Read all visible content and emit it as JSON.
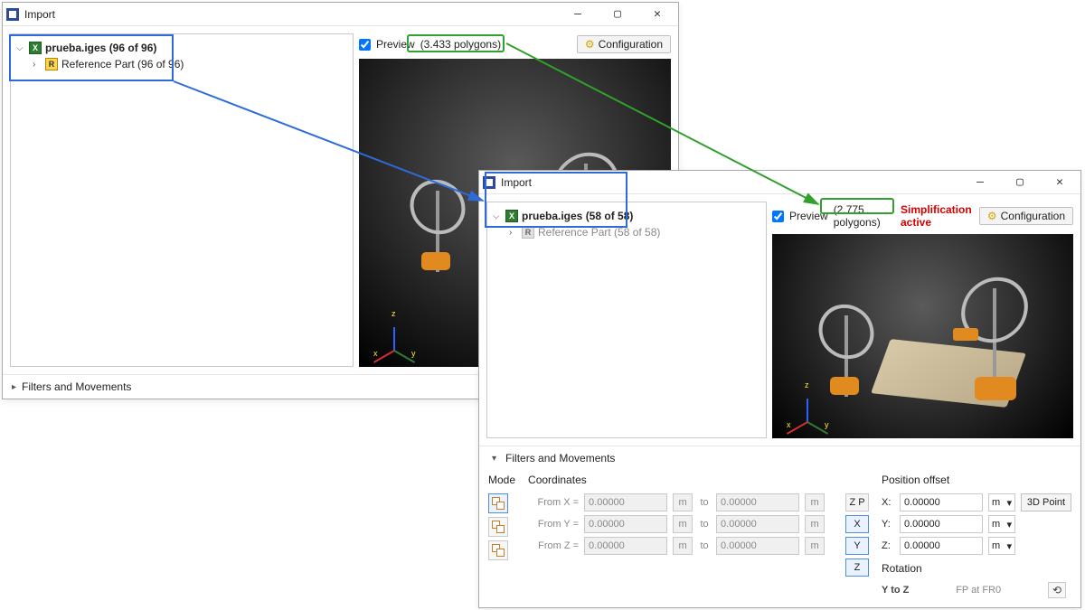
{
  "back": {
    "title": "Import",
    "tree": {
      "file": "prueba.iges (96 of 96)",
      "ref": "Reference Part (96 of 96)"
    },
    "preview_label": "Preview",
    "polycount": "(3.433 polygons)",
    "config_label": "Configuration",
    "footer": "Filters and Movements"
  },
  "front": {
    "title": "Import",
    "tree": {
      "file": "prueba.iges (58 of 58)",
      "ref": "Reference Part (58 of 58)"
    },
    "preview_label": "Preview",
    "polycount": "(2.775 polygons)",
    "simplification": "Simplification active",
    "config_label": "Configuration",
    "footer": "Filters and Movements",
    "fm": {
      "mode_label": "Mode",
      "coords_label": "Coordinates",
      "from_x": "From X =",
      "from_y": "From Y =",
      "from_z": "From Z =",
      "val": "0.00000",
      "unit": "m",
      "to": "to",
      "axis_zp": "Z P",
      "axis_x": "X",
      "axis_y": "Y",
      "axis_z": "Z",
      "pos_label": "Position offset",
      "px": "X:",
      "py": "Y:",
      "pz": "Z:",
      "btn_3dpoint": "3D Point",
      "rotation_label": "Rotation",
      "rot_ytoz": "Y to Z",
      "rot_fp": "FP at FR0",
      "reset_glyph": "⟲"
    }
  },
  "triad": {
    "x": "x",
    "y": "y",
    "z": "z"
  },
  "colors": {
    "blue": "#2f6bd6",
    "green": "#32a02c",
    "red": "#d60000"
  }
}
